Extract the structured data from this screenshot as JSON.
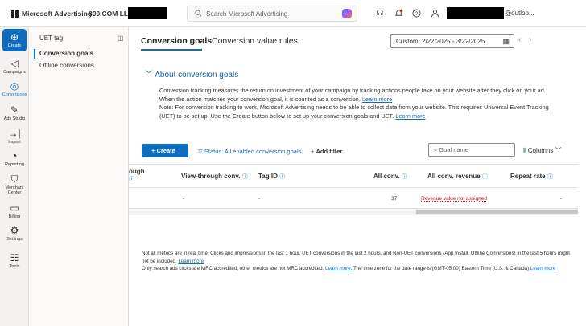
{
  "topbar": {
    "brand": "Microsoft Advertising",
    "account": "800.COM LLC (",
    "search_placeholder": "Search Microsoft Advertising",
    "user_email": "@outloo..."
  },
  "rail": [
    {
      "label": "Create",
      "icon": "plus-circle-icon"
    },
    {
      "label": "Campaigns",
      "icon": "megaphone-icon"
    },
    {
      "label": "Conversions",
      "icon": "target-icon"
    },
    {
      "label": "Ads Studio",
      "icon": "pencil-box-icon"
    },
    {
      "label": "Import",
      "icon": "import-arrow-icon"
    },
    {
      "label": "Reporting",
      "icon": "pie-chart-icon"
    },
    {
      "label": "Merchant Center",
      "icon": "shopping-bag-icon"
    },
    {
      "label": "Billing",
      "icon": "wallet-icon"
    },
    {
      "label": "Settings",
      "icon": "gear-icon"
    },
    {
      "label": "Tools",
      "icon": "tools-icon"
    }
  ],
  "subnav": {
    "items": [
      "UET tag",
      "Conversion goals",
      "Offline conversions"
    ]
  },
  "tabs": {
    "active": "Conversion goals",
    "second": "Conversion value rules"
  },
  "date_range": "Custom: 2/22/2025 - 3/22/2025",
  "about": {
    "title": "About conversion goals",
    "p1": "Conversion tracking measures the return on investment of your campaign by tracking actions people take on your website after they click on your ad. When the action matches your conversion goal, it is counted as a conversion.",
    "p1_link": "Learn more",
    "p2": "Note: For conversion tracking to work, Microsoft Advertising needs to be able to collect data from your website. This requires Universal Event Tracking (UET) to be set up. Use the Create button below to set up your conversion goals and UET.",
    "p2_link": "Learn more"
  },
  "toolbar": {
    "create": "Create",
    "status_filter": "Status: All enabled conversion goals",
    "add_filter": "Add filter",
    "goal_search_placeholder": "Goal name",
    "columns": "Columns"
  },
  "grid": {
    "headers": [
      "ough",
      "View-through conv.",
      "Tag ID",
      "All conv.",
      "All conv. revenue",
      "Repeat rate"
    ],
    "row": [
      "",
      "-",
      "-",
      "37",
      "Revenue value not assigned",
      "-"
    ]
  },
  "footnote": {
    "line1": "Not all metrics are in real time. Clicks and impressions in the last 1 hour, UET conversions in the last 2 hours, and Non-UET conversions (App Install, Offline Conversions) in the last 5 hours might not be included.",
    "line1_link": "Learn more",
    "line2": "Only search ads clicks are MRC accredited; other metrics are not MRC accredited.",
    "line2_link": "Learn more.",
    "line2b": "The time zone for the date range is (GMT-05:00) Eastern Time (U.S. & Canada)",
    "line2b_link": "Learn more"
  },
  "colors": {
    "accent": "#0f6cbd",
    "revenue_warning": "#c50f1f"
  }
}
